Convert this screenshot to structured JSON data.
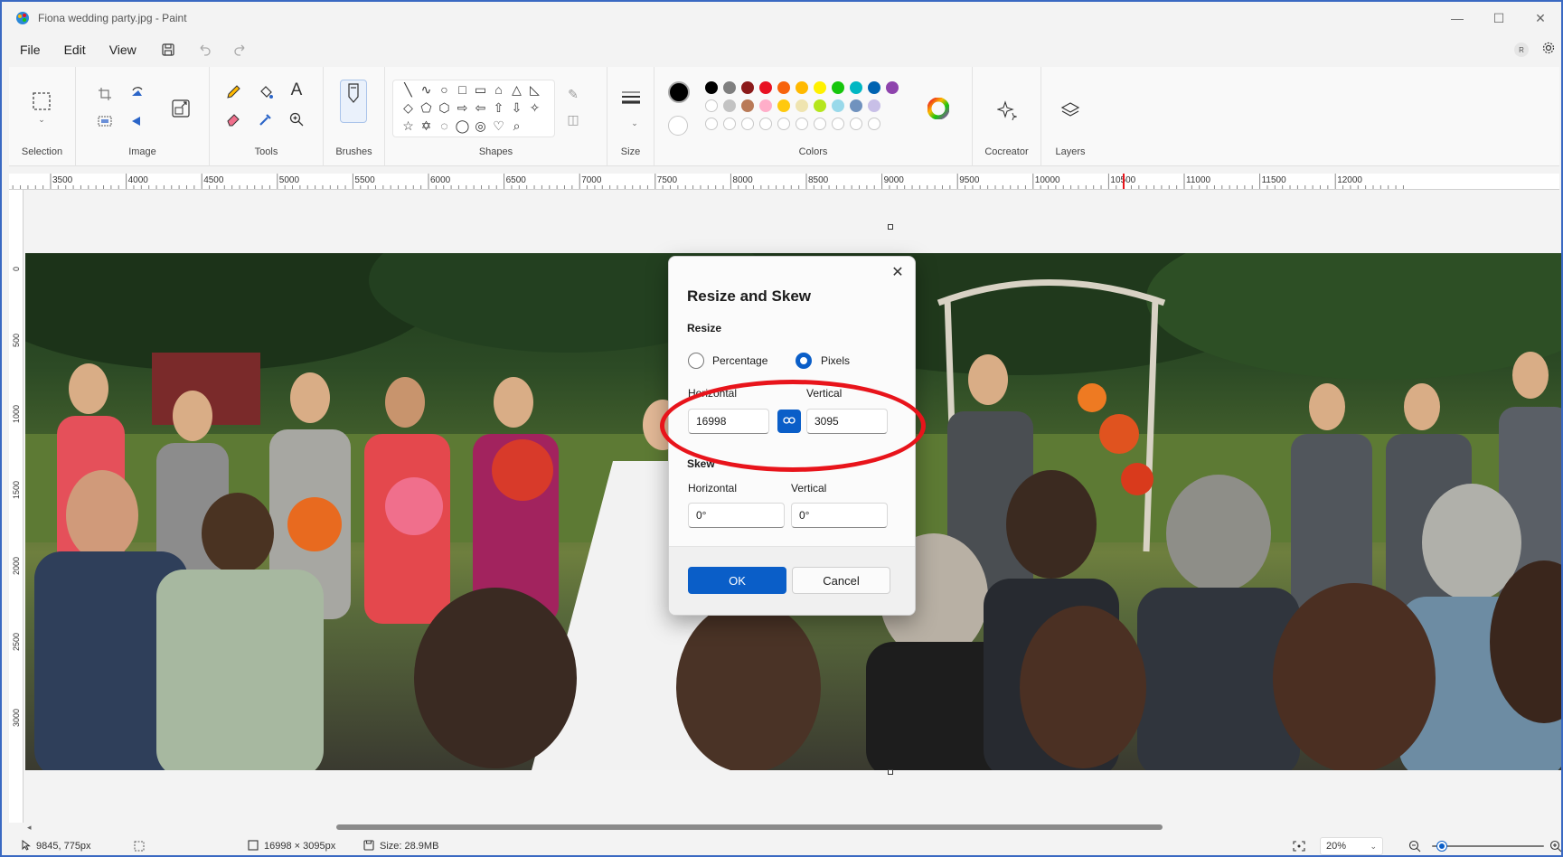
{
  "window": {
    "title": "Fiona wedding party.jpg - Paint",
    "minimize": "—",
    "maximize": "☐",
    "close": "✕"
  },
  "menu": {
    "file": "File",
    "edit": "Edit",
    "view": "View",
    "avatar_initial": "R"
  },
  "ribbon": {
    "selection": "Selection",
    "image": "Image",
    "tools": "Tools",
    "brushes": "Brushes",
    "shapes": "Shapes",
    "size": "Size",
    "colors": "Colors",
    "cocreator": "Cocreator",
    "layers": "Layers",
    "text_tool_glyph": "A",
    "shape_rows": [
      [
        "╲",
        "∿",
        "○",
        "□",
        "▭",
        "⌂",
        "△",
        "◺"
      ],
      [
        "◇",
        "⬠",
        "⬡",
        "⇨",
        "⇦",
        "⇧",
        "⇩",
        "✧"
      ],
      [
        "☆",
        "✡",
        "◌",
        "◯",
        "◎",
        "♡",
        "⌕"
      ]
    ]
  },
  "palette": {
    "primary": "#000000",
    "secondary": "#ffffff",
    "row1": [
      "#000000",
      "#7f7f7f",
      "#8b1a1a",
      "#e81123",
      "#f7630c",
      "#ffb900",
      "#fff100",
      "#16c60c",
      "#00b7c3",
      "#0063b1",
      "#8e44ad"
    ],
    "row2": [
      "#ffffff",
      "#c3c3c3",
      "#b97a57",
      "#ffaec9",
      "#ffc90e",
      "#efe4b0",
      "#b5e61d",
      "#99d9ea",
      "#7092be",
      "#c8bfe7"
    ]
  },
  "ruler": {
    "top_labels": [
      "3500",
      "4000",
      "4500",
      "5000",
      "5500",
      "6000",
      "6500",
      "7000",
      "7500",
      "8000",
      "8500",
      "9000",
      "9500",
      "10000",
      "10500",
      "11000",
      "11500",
      "12000"
    ],
    "left_labels": [
      "0",
      "500",
      "1000",
      "1500",
      "2000",
      "2500",
      "3000"
    ]
  },
  "dialog": {
    "title": "Resize and Skew",
    "resize_label": "Resize",
    "percentage_label": "Percentage",
    "pixels_label": "Pixels",
    "selected_unit": "Pixels",
    "resize_horizontal_label": "Horizontal",
    "resize_vertical_label": "Vertical",
    "resize_horizontal_value": "16998",
    "resize_vertical_value": "3095",
    "skew_label": "Skew",
    "skew_horizontal_label": "Horizontal",
    "skew_vertical_label": "Vertical",
    "skew_horizontal_value": "0°",
    "skew_vertical_value": "0°",
    "ok": "OK",
    "cancel": "Cancel",
    "close": "✕"
  },
  "status": {
    "cursor_position": "9845, 775px",
    "canvas_size": "16998 × 3095px",
    "file_size": "Size: 28.9MB",
    "zoom": "20%",
    "zoom_slider_fraction": 0.05
  },
  "colors": {
    "accent": "#0a5ec8",
    "annotation": "#e8141b"
  }
}
